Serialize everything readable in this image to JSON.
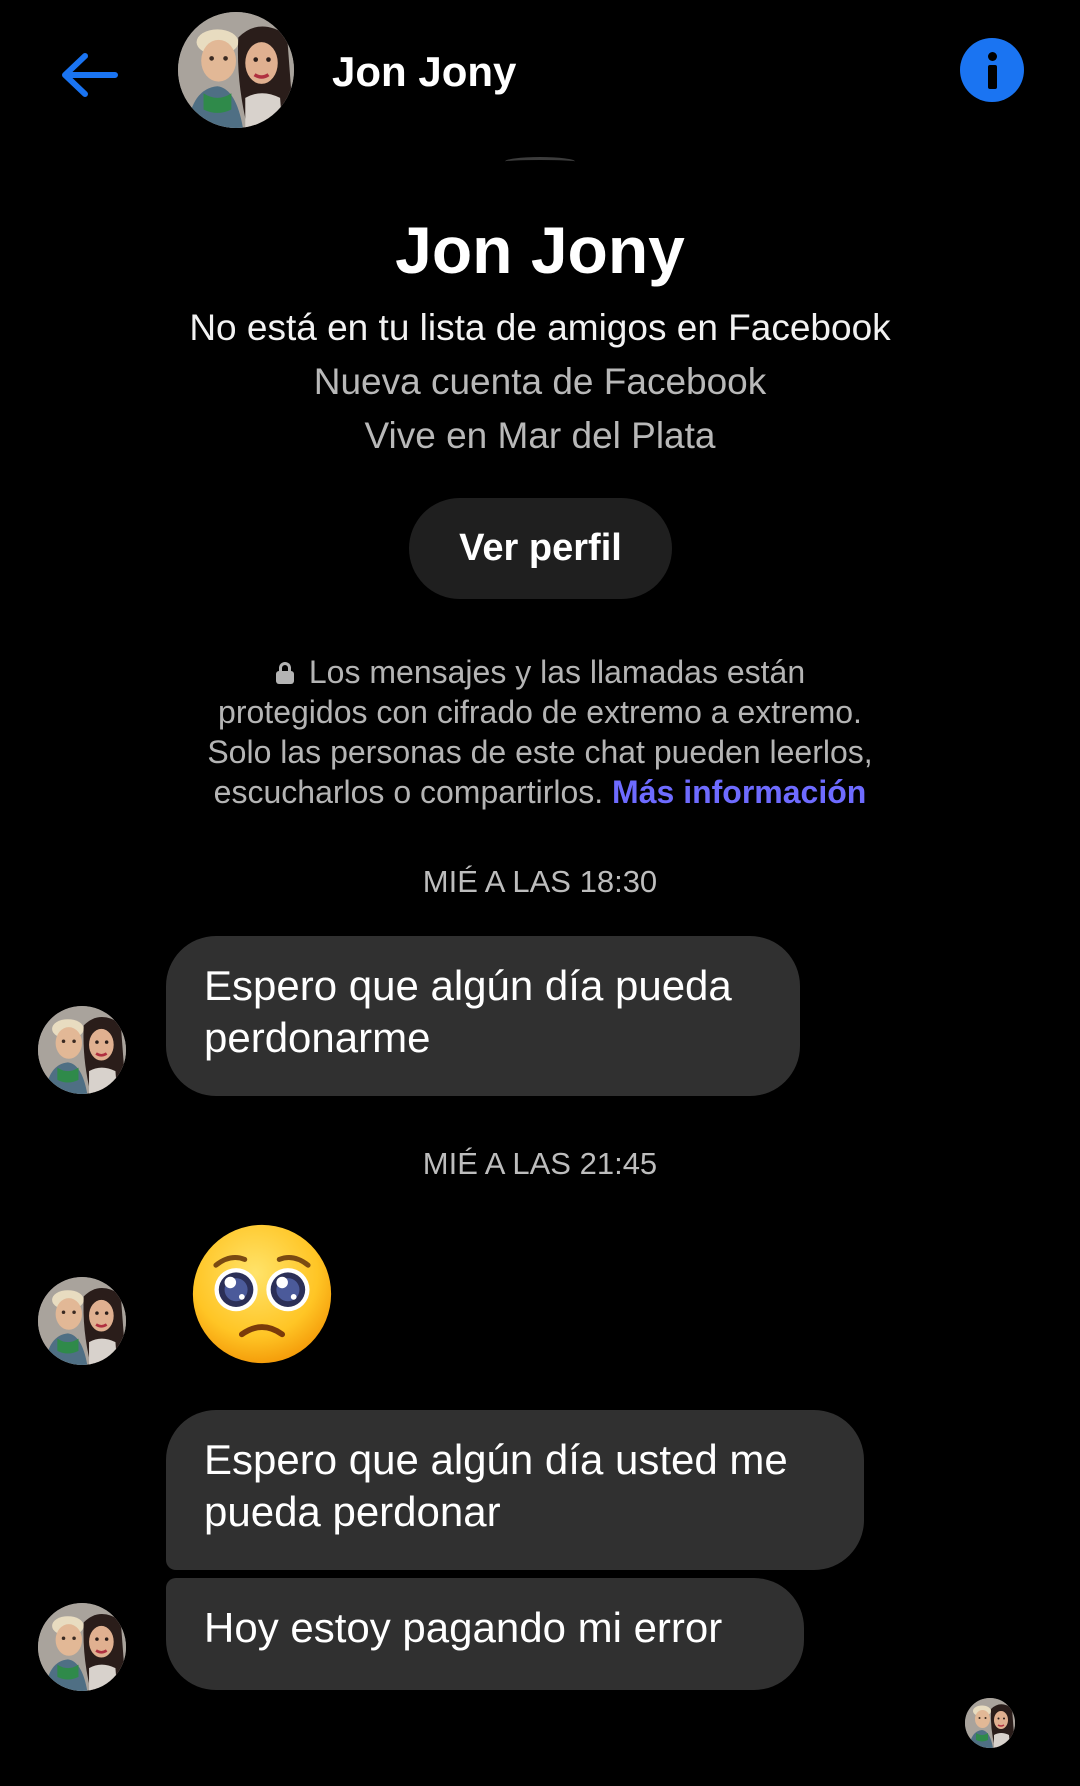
{
  "header": {
    "back_icon": "arrow-left-icon",
    "contact_name": "Jon Jony",
    "info_icon": "info-icon"
  },
  "profile": {
    "name": "Jon Jony",
    "line1": "No está en tu lista de amigos en Facebook",
    "line2": "Nueva cuenta de Facebook",
    "line3": "Vive en Mar del Plata",
    "view_profile_label": "Ver perfil"
  },
  "encryption_notice": {
    "lock_icon": "lock-icon",
    "line1": "Los mensajes y las llamadas están",
    "line2": "protegidos con cifrado de extremo a extremo.",
    "line3": "Solo las personas de este chat pueden leerlos,",
    "line4": "escucharlos o compartirlos.",
    "link": "Más información"
  },
  "messages": {
    "timestamp1": "MIÉ A LAS 18:30",
    "msg1": {
      "line1": "Espero que algún día pueda",
      "line2": "perdonarme"
    },
    "timestamp2": "MIÉ A LAS 21:45",
    "emoji_message": "pleading-face-emoji",
    "msg2": {
      "line1": "Espero que algún día usted me",
      "line2": "pueda perdonar"
    },
    "msg3": {
      "line1": "Hoy estoy pagando mi error"
    }
  },
  "colors": {
    "background": "#000000",
    "accent_blue": "#1a74f2",
    "bubble": "#303030",
    "link": "#6e6bff",
    "secondary_text": "#b8b8b8"
  }
}
